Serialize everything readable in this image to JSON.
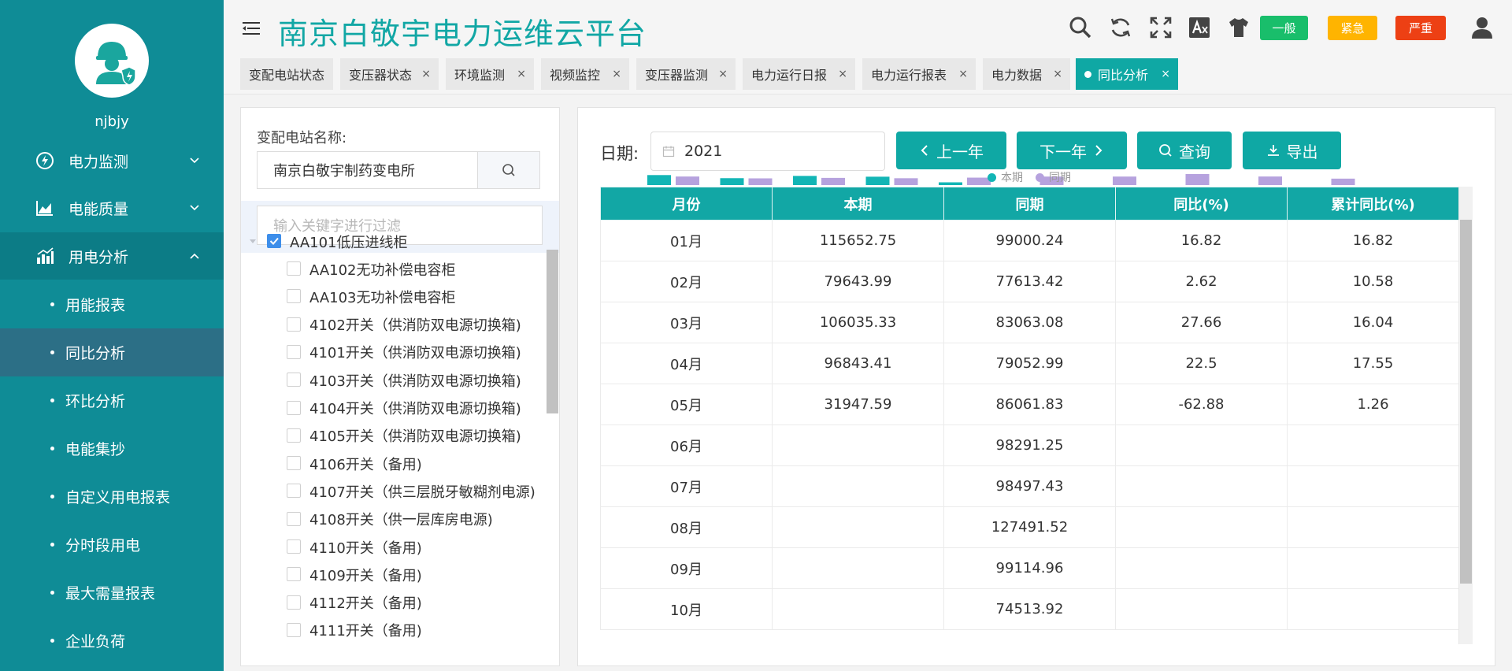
{
  "sidebar": {
    "username": "njbjy",
    "menus": [
      {
        "label": "电力监测"
      },
      {
        "label": "电能质量"
      },
      {
        "label": "用电分析"
      }
    ],
    "submenus": [
      {
        "label": "用能报表"
      },
      {
        "label": "同比分析"
      },
      {
        "label": "环比分析"
      },
      {
        "label": "电能集抄"
      },
      {
        "label": "自定义用电报表"
      },
      {
        "label": "分时段用电"
      },
      {
        "label": "最大需量报表"
      },
      {
        "label": "企业负荷"
      }
    ]
  },
  "header": {
    "title": "南京白敬宇电力运维云平台",
    "badges": [
      {
        "label": "一般",
        "color": "#19be6b"
      },
      {
        "label": "紧急",
        "color": "#ffb400"
      },
      {
        "label": "严重",
        "color": "#ed4014"
      }
    ]
  },
  "tabs": [
    {
      "label": "变配电站状态"
    },
    {
      "label": "变压器状态"
    },
    {
      "label": "环境监测"
    },
    {
      "label": "视频监控"
    },
    {
      "label": "变压器监测"
    },
    {
      "label": "电力运行日报"
    },
    {
      "label": "电力运行报表"
    },
    {
      "label": "电力数据"
    },
    {
      "label": "同比分析"
    }
  ],
  "tree_panel": {
    "station_label": "变配电站名称:",
    "station_value": "南京白敬宇制药变电所",
    "filter_placeholder": "输入关键字进行过滤",
    "root": "AA101低压进线柜",
    "children": [
      "AA102无功补偿电容柜",
      "AA103无功补偿电容柜",
      "4102开关（供消防双电源切换箱)",
      "4101开关（供消防双电源切换箱)",
      "4103开关（供消防双电源切换箱)",
      "4104开关（供消防双电源切换箱)",
      "4105开关（供消防双电源切换箱)",
      "4106开关（备用)",
      "4107开关（供三层脱牙敏糊剂电源)",
      "4108开关（供一层库房电源)",
      "4110开关（备用)",
      "4109开关（备用)",
      "4112开关（备用)",
      "4111开关（备用)"
    ]
  },
  "toolbar": {
    "date_label": "日期:",
    "date_value": "2021",
    "prev_label": "上一年",
    "next_label": "下一年",
    "query_label": "查询",
    "export_label": "导出"
  },
  "legend": {
    "current": "本期",
    "previous": "同期",
    "current_color": "#12b5b5",
    "previous_color": "#b6a2de"
  },
  "table": {
    "headers": [
      "月份",
      "本期",
      "同期",
      "同比(%)",
      "累计同比(%)"
    ],
    "rows": [
      [
        "01月",
        "115652.75",
        "99000.24",
        "16.82",
        "16.82"
      ],
      [
        "02月",
        "79643.99",
        "77613.42",
        "2.62",
        "10.58"
      ],
      [
        "03月",
        "106035.33",
        "83063.08",
        "27.66",
        "16.04"
      ],
      [
        "04月",
        "96843.41",
        "79052.99",
        "22.5",
        "17.55"
      ],
      [
        "05月",
        "31947.59",
        "86061.83",
        "-62.88",
        "1.26"
      ],
      [
        "06月",
        "",
        "98291.25",
        "",
        ""
      ],
      [
        "07月",
        "",
        "98497.43",
        "",
        ""
      ],
      [
        "08月",
        "",
        "127491.52",
        "",
        ""
      ],
      [
        "09月",
        "",
        "99114.96",
        "",
        ""
      ],
      [
        "10月",
        "",
        "74513.92",
        "",
        ""
      ]
    ]
  }
}
